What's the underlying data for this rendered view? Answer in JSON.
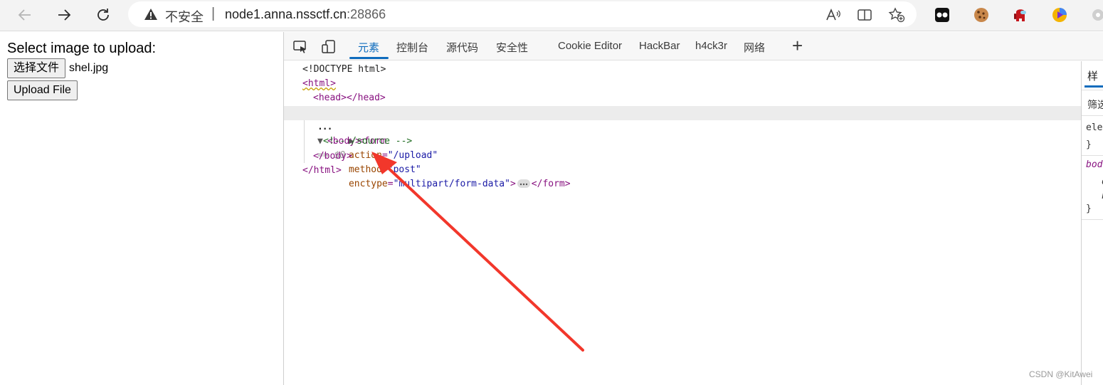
{
  "browser": {
    "address_bar": {
      "security_label": "不安全",
      "separator": "|",
      "url_host": "node1.anna.nssctf.cn",
      "url_port": ":28866"
    }
  },
  "page": {
    "heading": "Select image to upload:",
    "choose_file_label": "选择文件",
    "selected_file": "shel.jpg",
    "upload_button": "Upload File"
  },
  "devtools": {
    "tabs": [
      "元素",
      "控制台",
      "源代码",
      "安全性",
      "Cookie Editor",
      "HackBar",
      "h4ck3r",
      "网络"
    ],
    "active_tab": "元素",
    "dom": {
      "doctype": "<!DOCTYPE html>",
      "html_open": "<html>",
      "head": "<head></head>",
      "body_open": "<body>",
      "body_marker": "== $0",
      "form_tag": "form",
      "form_attrs": [
        {
          "name": "action",
          "value": "\"/upload\""
        },
        {
          "name": "method",
          "value": "\"post\""
        },
        {
          "name": "enctype",
          "value": "\"multipart/form-data\""
        }
      ],
      "form_close": "</form>",
      "comment": "<!-- /source -->",
      "body_close": "</body>",
      "html_close": "</html>",
      "ellipsis": "..."
    },
    "styles_pane": {
      "tab": "样",
      "filter": "筛选",
      "element_rule": "eleı",
      "close_brace": "}",
      "body_rule": "bod",
      "prop1": "d",
      "prop2": "n"
    }
  },
  "watermark": "CSDN @KitAwei",
  "colors": {
    "accent": "#0f6cbd",
    "annotation_arrow": "#f2372b"
  }
}
